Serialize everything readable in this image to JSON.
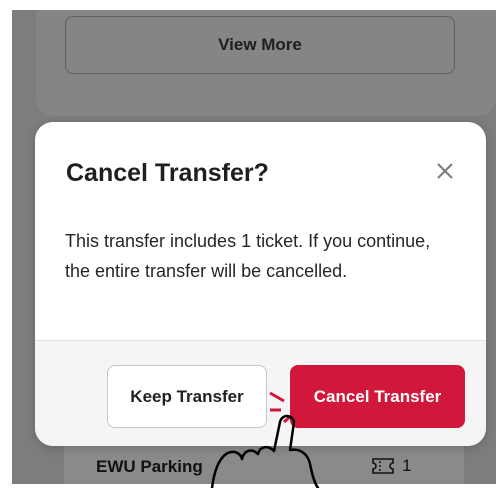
{
  "background": {
    "view_more_label": "View More",
    "list_item": {
      "name": "EWU Parking",
      "ticket_icon": "ticket-icon",
      "count": "1"
    }
  },
  "modal": {
    "title": "Cancel Transfer?",
    "close_icon": "close-icon",
    "body": "This transfer includes 1 ticket. If you continue, the entire transfer will be cancelled.",
    "keep_label": "Keep Transfer",
    "cancel_label": "Cancel Transfer"
  },
  "overlay": {
    "tap_indicator_icon": "tap-hand-icon"
  },
  "colors": {
    "accent": "#d1183a",
    "backdrop": "#7d7d7d",
    "modal_bg": "#ffffff",
    "footer_bg": "#f5f5f5"
  }
}
